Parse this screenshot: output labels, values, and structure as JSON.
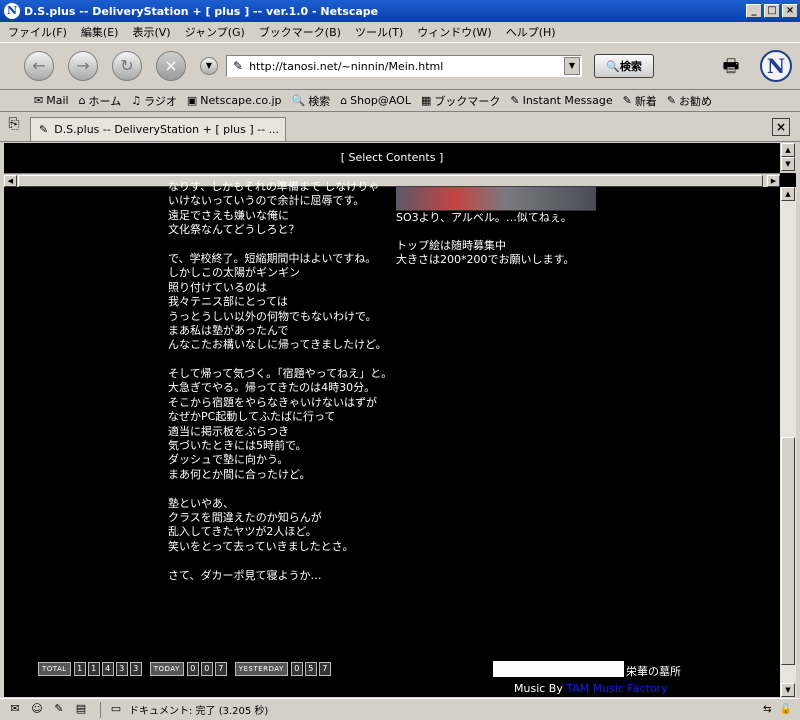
{
  "window": {
    "title": "D.S.plus -- DeliveryStation + [ plus ] -- ver.1.0 - Netscape",
    "minimize": "_",
    "maximize": "□",
    "close": "×"
  },
  "menu": [
    "ファイル(F)",
    "編集(E)",
    "表示(V)",
    "ジャンプ(G)",
    "ブックマーク(B)",
    "ツール(T)",
    "ウィンドウ(W)",
    "ヘルプ(H)"
  ],
  "nav": {
    "back": "←",
    "forward": "→",
    "reload": "↻",
    "stop": "×",
    "url": "http://tanosi.net/~ninnin/Mein.html",
    "search_label": "検索",
    "logo": "N"
  },
  "bookmarks": [
    {
      "icon": "✉",
      "label": "Mail"
    },
    {
      "icon": "⌂",
      "label": "ホーム"
    },
    {
      "icon": "♫",
      "label": "ラジオ"
    },
    {
      "icon": "▣",
      "label": "Netscape.co.jp"
    },
    {
      "icon": "🔍",
      "label": "検索"
    },
    {
      "icon": "⌂",
      "label": "Shop@AOL"
    },
    {
      "icon": "▦",
      "label": "ブックマーク"
    },
    {
      "icon": "✎",
      "label": "Instant Message"
    },
    {
      "icon": "✎",
      "label": "新着"
    },
    {
      "icon": "✎",
      "label": "お勧め"
    }
  ],
  "tab": {
    "label": "D.S.plus -- DeliveryStation + [ plus ] -- ...",
    "close": "×"
  },
  "page": {
    "select_contents": "[ Select Contents ]",
    "diary_lines": [
      "なりす、しかもそれの準備まで しなけりゃ",
      "いけないっていうので余計に屈辱です。",
      "遠足でさえも嫌いな俺に",
      "文化祭なんてどうしろと？",
      "",
      "で、学校終了。短縮期間中はよいですね。",
      "しかしこの太陽がギンギン",
      "照り付けているのは",
      "我々テニス部にとっては",
      "うっとうしい以外の何物でもないわけで。",
      "まあ私は塾があったんで",
      "んなこたお構いなしに帰ってきましたけど。",
      "",
      "そして帰って気づく。「宿題やってねえ」と。",
      "大急ぎでやる。帰ってきたのは4時30分。",
      "そこから宿題をやらなきゃいけないはずが",
      "なぜかPC起動してふたばに行って",
      "適当に掲示板をぶらつき",
      "気づいたときには5時前で。",
      "ダッシュで塾に向かう。",
      "まあ何とか間に合ったけど。",
      "",
      "塾といやあ、",
      "クラスを間違えたのか知らんが",
      "乱入してきたヤツが2人ほど。",
      "笑いをとって去っていきましたとさ。",
      "",
      "さて、ダカーポ見て寝ようか…"
    ],
    "side_lines": [
      "SO3より、アルベル。…似てねぇ。",
      "",
      "トップ絵は随時募集中",
      "大きさは200*200でお願いします。"
    ],
    "counters": [
      {
        "label": "TOTAL",
        "digits": [
          "1",
          "1",
          "4",
          "3",
          "3"
        ]
      },
      {
        "label": "TODAY",
        "digits": [
          "0",
          "0",
          "7"
        ]
      },
      {
        "label": "YESTERDAY",
        "digits": [
          "0",
          "5",
          "7"
        ]
      }
    ],
    "footer_title": "栄華の墓所",
    "music_prefix": "Music By",
    "music_link": "TAM Music Factory"
  },
  "status": {
    "message": "ドキュメント: 完了 (3.205 秒)"
  },
  "colors": {
    "page_bg": "#000000",
    "link": "#1a1aff",
    "titlebar": "#0a3fa8"
  }
}
